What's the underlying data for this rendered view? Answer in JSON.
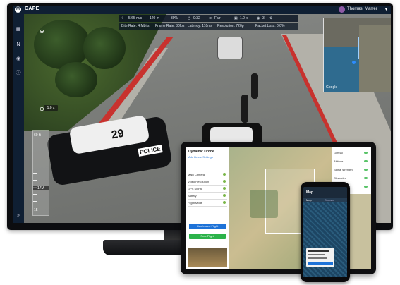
{
  "app": {
    "name": "CAPE",
    "logo": "motorola-logo",
    "user": "Thomas, Marrer"
  },
  "telemetry": {
    "speed": "5.65 m/s",
    "altitude": "120 m",
    "gps": "39%",
    "time": "0:32",
    "signal": "Fair",
    "zoom": "1.0 x",
    "battery": "3"
  },
  "stream": {
    "bitrate": "Bite Rate: 4 Mbits",
    "framerate": "Frame Rate: 30fps",
    "latency": "Latency: 110ms",
    "resolution": "Resolution: 720p",
    "packet_loss": "Packet Loss: 0.0%"
  },
  "map_overlay": {
    "attribution": "Google"
  },
  "zoom_badge": "1.0 x",
  "altitude_scale": {
    "labels": [
      "60 ft",
      "17M",
      "15"
    ],
    "current": "17M"
  },
  "vehicle_text": {
    "roof_number": "29",
    "door_text": "POLICE"
  },
  "tablet": {
    "panel_title": "Dynamic Drone",
    "panel_subtitle": "Add Drone Settings",
    "items": [
      "Main Camera",
      "Video Resolution",
      "GPS Signal",
      "Battery",
      "Flight Mode"
    ],
    "primary_button": "Geofenced Flight",
    "secondary_button": "Free Flight",
    "right_items": [
      "Gimbal",
      "Altitude",
      "Signal strength",
      "Obstacles",
      "Drift"
    ]
  },
  "phone": {
    "header": "Map",
    "tabs": [
      "Map",
      "Stream"
    ]
  },
  "colors": {
    "topbar": "#0f1f33",
    "accent_blue": "#1e73d8",
    "accent_green": "#2cb34a",
    "curb": "#c8322e"
  },
  "icons": [
    "grid-icon",
    "compass-icon",
    "record-icon",
    "info-icon",
    "expand-icon",
    "zoom-in-icon",
    "zoom-out-icon",
    "wifi-icon",
    "battery-icon",
    "timer-icon",
    "camera-icon",
    "eye-icon",
    "settings-icon",
    "chevron-down-icon"
  ]
}
